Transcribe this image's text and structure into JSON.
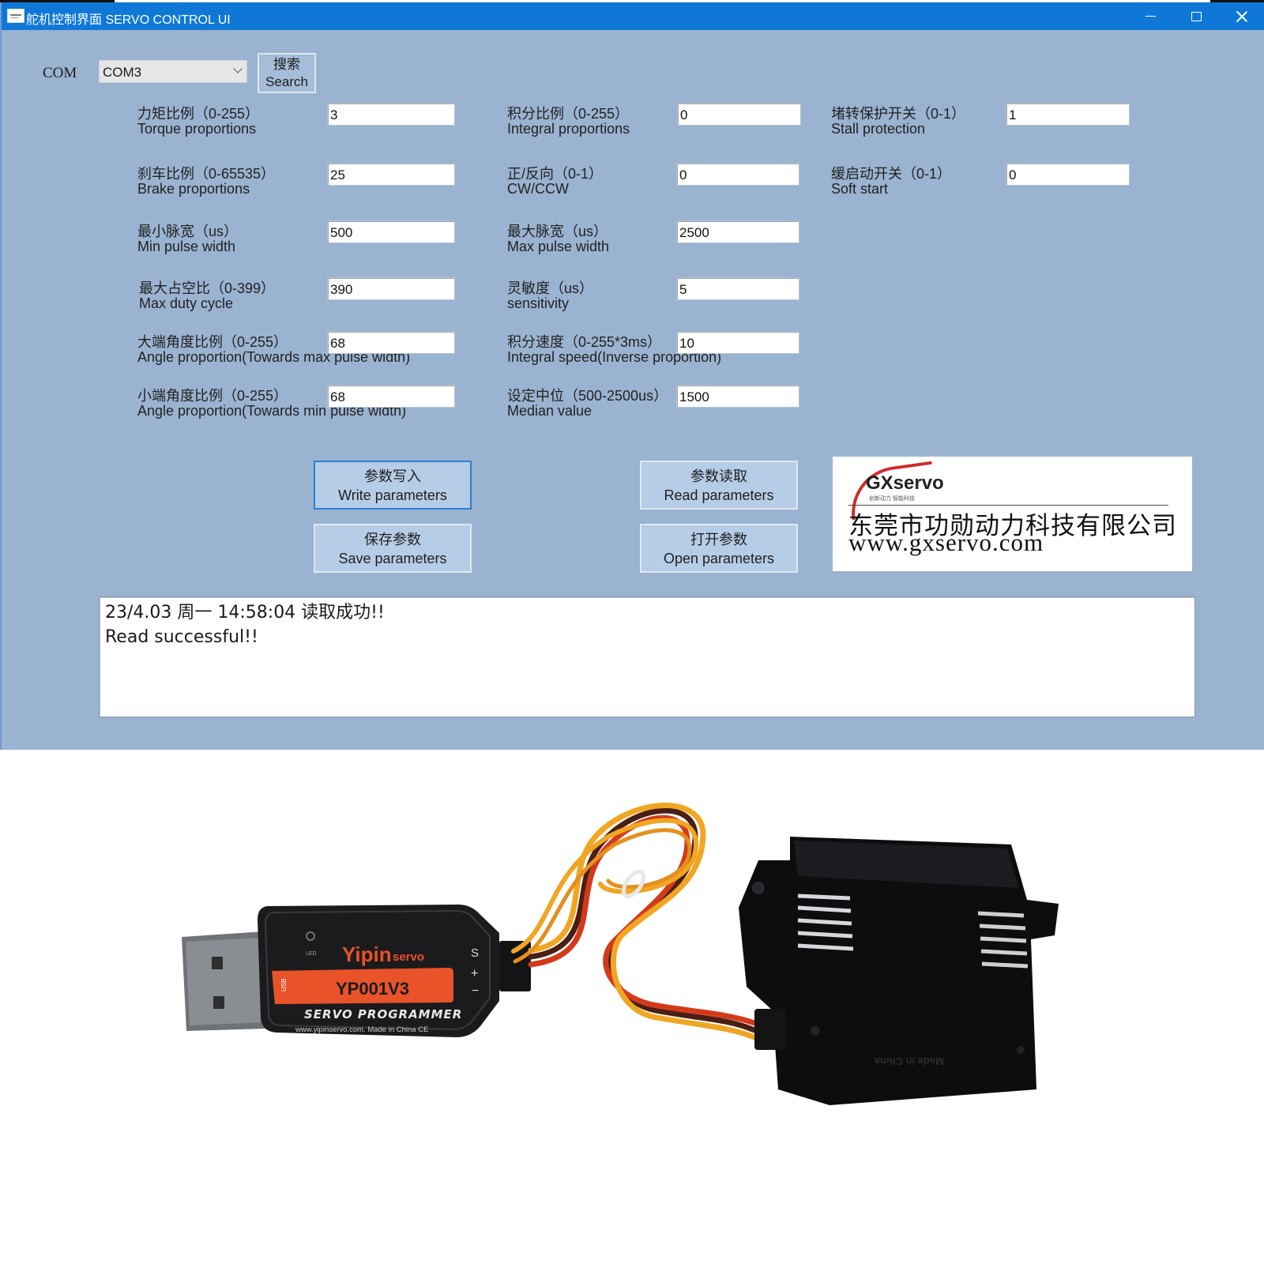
{
  "window": {
    "title": "舵机控制界面 SERVO CONTROL UI",
    "controls": {
      "minimize": "minimize",
      "maximize": "maximize",
      "close": "close"
    }
  },
  "com": {
    "label": "COM",
    "selected": "COM3",
    "search_zh": "搜索",
    "search_en": "Search"
  },
  "params": {
    "torque": {
      "zh": "力矩比例（0-255）",
      "en": "Torque proportions",
      "value": "3"
    },
    "brake": {
      "zh": "刹车比例（0-65535）",
      "en": "Brake proportions",
      "value": "25"
    },
    "min_pulse": {
      "zh": "最小脉宽（us）",
      "en": "Min pulse width",
      "value": "500"
    },
    "max_duty": {
      "zh": "最大占空比（0-399）",
      "en": "Max duty cycle",
      "value": "390"
    },
    "angle_max": {
      "zh": "大端角度比例（0-255）",
      "en": "Angle proportion(Towards max pulse width)",
      "value": "68"
    },
    "angle_min": {
      "zh": "小端角度比例（0-255）",
      "en": "Angle proportion(Towards min pulse width)",
      "value": "68"
    },
    "integral": {
      "zh": "积分比例（0-255）",
      "en": "Integral proportions",
      "value": "0"
    },
    "direction": {
      "zh": "正/反向（0-1）",
      "en": "CW/CCW",
      "value": "0"
    },
    "max_pulse": {
      "zh": "最大脉宽（us）",
      "en": "Max pulse width",
      "value": "2500"
    },
    "sensitivity": {
      "zh": "灵敏度（us）",
      "en": "sensitivity",
      "value": "5"
    },
    "integral_speed": {
      "zh": "积分速度（0-255*3ms）",
      "en": "Integral speed(Inverse proportion)",
      "value": "10"
    },
    "median": {
      "zh": "设定中位（500-2500us）",
      "en": "Median value",
      "value": "1500"
    },
    "stall": {
      "zh": "堵转保护开关（0-1）",
      "en": "Stall protection",
      "value": "1"
    },
    "soft_start": {
      "zh": "缓启动开关（0-1）",
      "en": "Soft start",
      "value": "0"
    }
  },
  "buttons": {
    "write": {
      "zh": "参数写入",
      "en": "Write parameters"
    },
    "read": {
      "zh": "参数读取",
      "en": "Read parameters"
    },
    "save": {
      "zh": "保存参数",
      "en": "Save parameters"
    },
    "open": {
      "zh": "打开参数",
      "en": "Open parameters"
    }
  },
  "logo": {
    "brand": "GXservo",
    "tagline": "创新动力 智能科技",
    "company": "东莞市功勋动力科技有限公司",
    "url": "www.gxservo.com",
    "accent": "#d22a2a"
  },
  "log": {
    "line1": "23/4.03 周一 14:58:04 读取成功!!",
    "line2": "Read successful!!"
  },
  "photo": {
    "programmer_brand_main": "Yipin",
    "programmer_brand_sub": "servo",
    "programmer_model": "YP001V3",
    "programmer_title": "SERVO PROGRAMMER",
    "programmer_footer": "www.yipinservo.com.  Made in China  CE",
    "led_label": "LED",
    "usb_label": "USB",
    "pin_s": "S",
    "pin_plus": "+",
    "pin_minus": "−",
    "servo_text": "Made in China",
    "colors": {
      "label_orange": "#e8532a",
      "brand_orange": "#e8532a",
      "wire_yellow": "#f0a623",
      "wire_red": "#d33a1c",
      "wire_brown": "#4a1e14"
    }
  },
  "colors": {
    "titlebar": "#0f78d7",
    "client_bg": "#9ab3d1",
    "button_bg": "#b6cde7",
    "focus_border": "#2d7fd4"
  }
}
